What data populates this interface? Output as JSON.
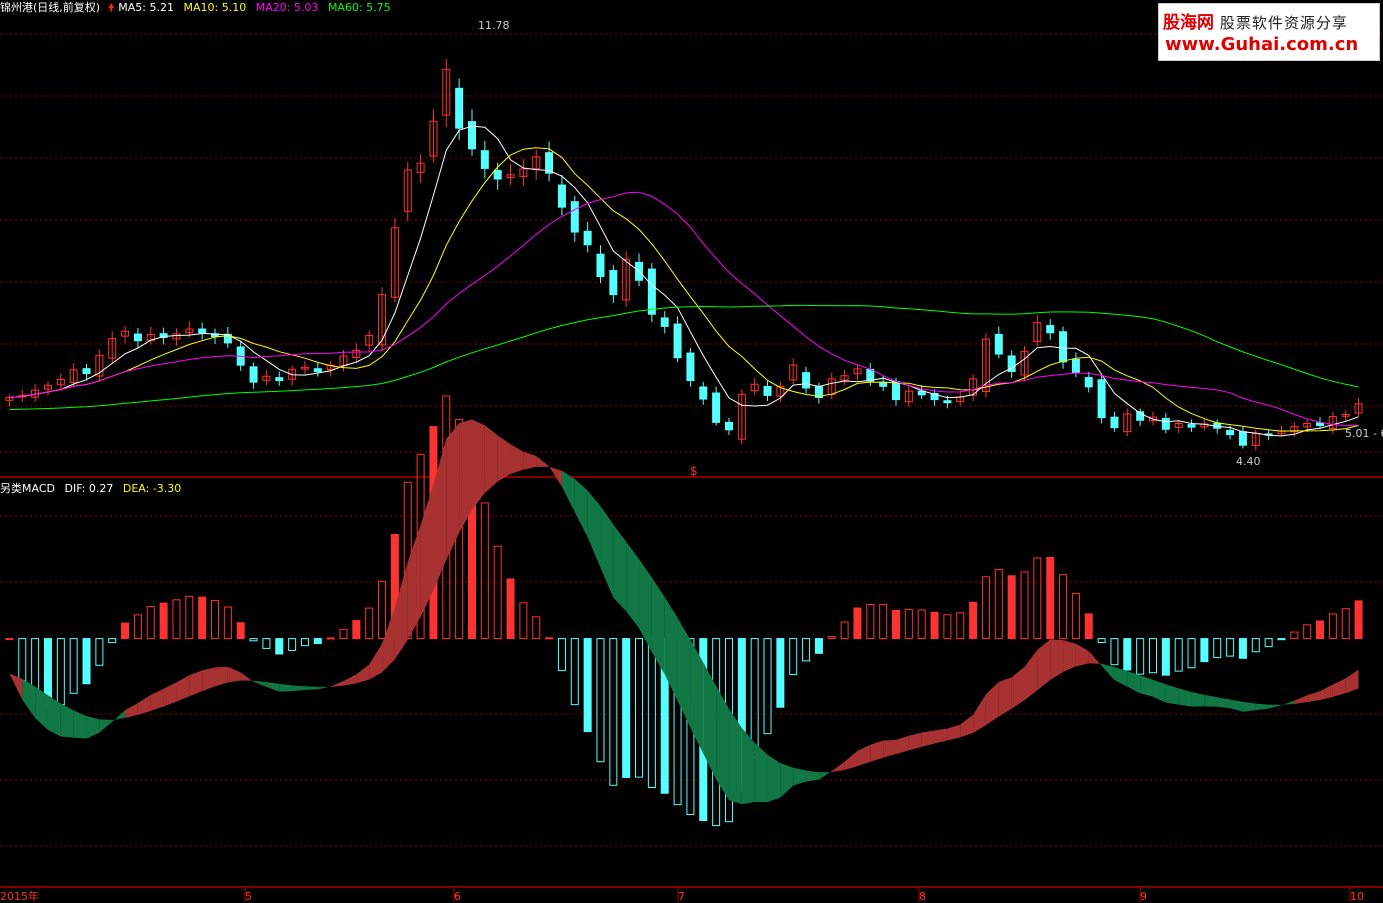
{
  "price_panel": {
    "title": "锦州港(日线,前复权)",
    "ma_labels": [
      {
        "text": "MA5: 5.21",
        "color": "#ffffff"
      },
      {
        "text": "MA10: 5.10",
        "color": "#ffff00"
      },
      {
        "text": "MA20: 5.03",
        "color": "#ff00ff"
      },
      {
        "text": "MA60: 5.75",
        "color": "#00ff00"
      }
    ],
    "annotations": {
      "high": "11.78",
      "low": "4.40",
      "last": "5.01 - 6"
    },
    "marker": "$"
  },
  "macd_panel": {
    "title": "另类MACD",
    "dif": "DIF: 0.27",
    "dea": "DEA: -3.30"
  },
  "x_axis": {
    "labels": [
      "2015年",
      "5",
      "6",
      "7",
      "8",
      "9",
      "10"
    ]
  },
  "logo": {
    "line1_brand": "股海网",
    "line1_tag": "股票软件资源分享",
    "line2": "www.Guhai.com.cn"
  },
  "colors": {
    "up": "#ff3232",
    "down": "#54ffff",
    "ma5": "#ffffff",
    "ma10": "#ffff00",
    "ma20": "#ff00ff",
    "ma60": "#00ff00",
    "grid": "#8b0000"
  },
  "chart_data": {
    "type": "candlestick",
    "price_ylim": [
      4.0,
      12.6
    ],
    "closes": [
      5.33,
      5.37,
      5.47,
      5.56,
      5.67,
      5.85,
      5.78,
      6.12,
      6.44,
      6.58,
      6.4,
      6.52,
      6.46,
      6.53,
      6.62,
      6.55,
      6.48,
      6.36,
      5.94,
      5.62,
      5.73,
      5.65,
      5.86,
      5.9,
      5.82,
      5.94,
      6.11,
      6.22,
      6.5,
      7.27,
      8.53,
      9.62,
      9.75,
      10.54,
      11.52,
      10.41,
      10.02,
      9.65,
      9.45,
      9.53,
      9.64,
      9.87,
      9.56,
      8.92,
      8.45,
      8.21,
      7.61,
      7.27,
      7.93,
      7.54,
      6.9,
      6.67,
      6.08,
      5.65,
      5.3,
      4.86,
      4.72,
      5.39,
      5.58,
      5.37,
      5.54,
      5.94,
      5.51,
      5.33,
      5.68,
      5.74,
      5.87,
      5.64,
      5.54,
      5.29,
      5.45,
      5.38,
      5.29,
      5.23,
      5.34,
      5.68,
      6.43,
      6.15,
      5.82,
      6.2,
      6.74,
      6.55,
      6.0,
      5.8,
      5.53,
      4.95,
      4.76,
      5.02,
      4.9,
      4.96,
      4.73,
      4.84,
      4.77,
      4.83,
      4.75,
      4.63,
      4.43,
      4.65,
      4.62,
      4.7,
      4.78,
      4.84,
      4.8,
      4.97,
      5.01,
      5.21
    ],
    "ma_last": {
      "MA5": 5.21,
      "MA10": 5.1,
      "MA20": 5.03,
      "MA60": 5.75
    },
    "annotations": {
      "high": 11.78,
      "low": 4.4
    },
    "macd_ylim": [
      -3.6,
      2.2
    ],
    "dif_last": 0.27,
    "dea_last": -3.3,
    "x_axis_labels": [
      "2015年",
      "5",
      "6",
      "7",
      "8",
      "9",
      "10"
    ]
  }
}
